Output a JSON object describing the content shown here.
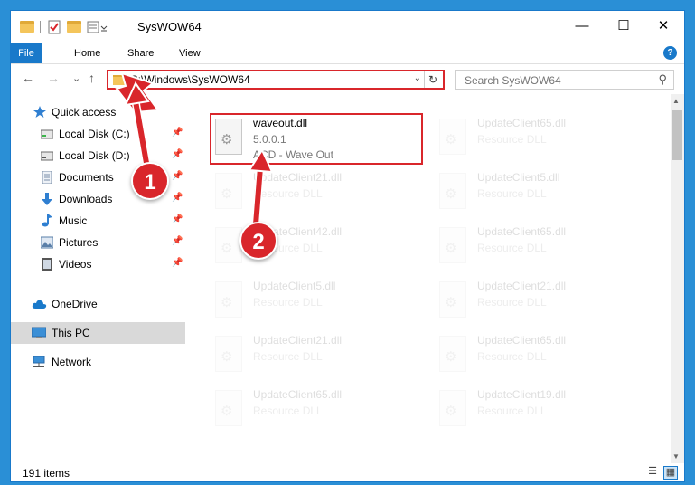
{
  "window": {
    "title": "SysWOW64",
    "controls": {
      "minimize": "—",
      "maximize": "☐",
      "close": "✕"
    }
  },
  "ribbon": {
    "tabs": [
      "File",
      "Home",
      "Share",
      "View"
    ],
    "help": "?"
  },
  "nav": {
    "back": "←",
    "forward": "→",
    "recent": "⌄",
    "up": "↑",
    "address": "C:\\Windows\\SysWOW64",
    "address_dropdown": "⌄",
    "refresh": "↻",
    "search_placeholder": "Search SysWOW64",
    "search_icon": "⚲"
  },
  "sidebar": {
    "items": [
      {
        "label": "Quick access",
        "icon": "star-icon",
        "color": "#2f7fd1",
        "pinned": false
      },
      {
        "label": "Local Disk (C:)",
        "icon": "drive-icon",
        "color": "#6b6b6b",
        "pinned": true
      },
      {
        "label": "Local Disk (D:)",
        "icon": "drive-icon",
        "color": "#6b6b6b",
        "pinned": true
      },
      {
        "label": "Documents",
        "icon": "documents-icon",
        "color": "#7a8fa8",
        "pinned": true
      },
      {
        "label": "Downloads",
        "icon": "download-icon",
        "color": "#2f7fd1",
        "pinned": true
      },
      {
        "label": "Music",
        "icon": "music-icon",
        "color": "#2f7fd1",
        "pinned": true
      },
      {
        "label": "Pictures",
        "icon": "pictures-icon",
        "color": "#5a7fa8",
        "pinned": true
      },
      {
        "label": "Videos",
        "icon": "video-icon",
        "color": "#555555",
        "pinned": true
      },
      {
        "label": "OneDrive",
        "icon": "cloud-icon",
        "color": "#1979ca",
        "pinned": false
      },
      {
        "label": "This PC",
        "icon": "computer-icon",
        "color": "#3b8fd6",
        "pinned": false
      },
      {
        "label": "Network",
        "icon": "network-icon",
        "color": "#3b8fd6",
        "pinned": false
      }
    ],
    "pin_glyph": "📌"
  },
  "files": {
    "highlighted": {
      "name": "waveout.dll",
      "version": "5.0.0.1",
      "description": "ACD - Wave Out"
    },
    "faded": [
      {
        "name": "UpdateClient65.dll",
        "type": "Resource DLL"
      },
      {
        "name": "UpdateClient21.dll",
        "type": "Resource DLL"
      },
      {
        "name": "UpdateClient5.dll",
        "type": "Resource DLL"
      },
      {
        "name": "UpdateClient42.dll",
        "type": "Resource DLL"
      },
      {
        "name": "UpdateClient65.dll",
        "type": "Resource DLL"
      },
      {
        "name": "UpdateClient5.dll",
        "type": "Resource DLL"
      },
      {
        "name": "UpdateClient21.dll",
        "type": "Resource DLL"
      },
      {
        "name": "UpdateClient21.dll",
        "type": "Resource DLL"
      },
      {
        "name": "UpdateClient65.dll",
        "type": "Resource DLL"
      },
      {
        "name": "UpdateClient65.dll",
        "type": "Resource DLL"
      },
      {
        "name": "UpdateClient19.dll",
        "type": "Resource DLL"
      }
    ]
  },
  "status": {
    "item_count": "191 items"
  },
  "annotations": {
    "step1": "1",
    "step2": "2",
    "color": "#d9262b"
  }
}
